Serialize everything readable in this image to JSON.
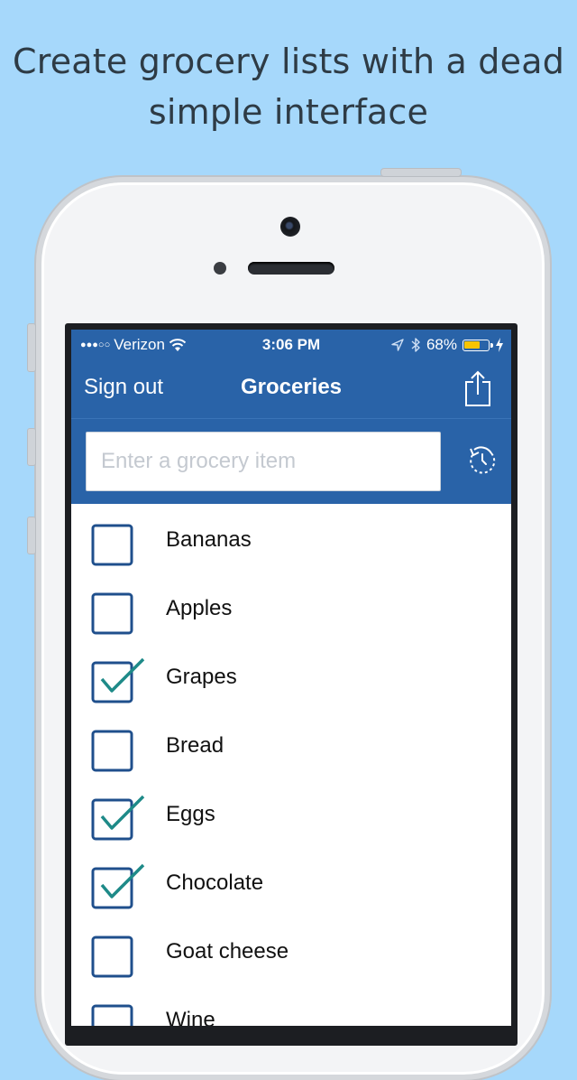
{
  "headline": {
    "line1": "Create grocery lists with a dead",
    "line2": "simple interface"
  },
  "status_bar": {
    "carrier": "Verizon",
    "time": "3:06 PM",
    "battery_percent": "68%",
    "battery_level": 0.68,
    "signal_bars_filled": 3,
    "signal_bars_total": 5
  },
  "nav": {
    "left_button": "Sign out",
    "title": "Groceries"
  },
  "input": {
    "placeholder": "Enter a grocery item",
    "value": ""
  },
  "items": [
    {
      "label": "Bananas",
      "checked": false
    },
    {
      "label": "Apples",
      "checked": false
    },
    {
      "label": "Grapes",
      "checked": true
    },
    {
      "label": "Bread",
      "checked": false
    },
    {
      "label": "Eggs",
      "checked": true
    },
    {
      "label": "Chocolate",
      "checked": true
    },
    {
      "label": "Goat cheese",
      "checked": false
    },
    {
      "label": "Wine",
      "checked": false
    }
  ],
  "colors": {
    "background": "#a6d8fb",
    "app_bar": "#2963a8",
    "checkbox_border": "#1f4f8c",
    "checkmark": "#1e8a88",
    "battery_fill": "#f8c400"
  },
  "icons": {
    "share": "share-icon",
    "undo": "history-undo-icon",
    "wifi": "wifi-icon",
    "location": "location-arrow-icon",
    "bluetooth": "bluetooth-icon",
    "charging": "charging-bolt-icon",
    "checkmark": "checkmark-icon"
  }
}
